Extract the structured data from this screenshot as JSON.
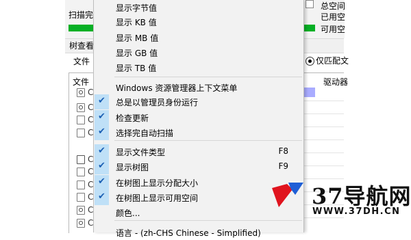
{
  "background_left": {
    "scan_label": "扫描完",
    "tab_label": "树查看",
    "file_types_label": "文件",
    "list_header": "文件",
    "rows": [
      {
        "icon": "gear-doc-icon",
        "letter": "C"
      },
      {
        "icon": "gear-doc-icon",
        "letter": "C"
      },
      {
        "icon": "document-icon",
        "letter": "C"
      },
      {
        "icon": "document-icon",
        "letter": "C"
      },
      {
        "icon": "shortcut-icon",
        "letter": "C"
      },
      {
        "icon": "document-icon",
        "letter": "C"
      },
      {
        "icon": "document-icon",
        "letter": "C"
      },
      {
        "icon": "document-icon",
        "letter": "C"
      },
      {
        "icon": "gear-doc-icon",
        "letter": "C"
      },
      {
        "icon": "gear-doc-icon",
        "letter": "C"
      }
    ]
  },
  "background_right": {
    "total_space": "总空间",
    "used_space": "已用空",
    "free_space": "可用空",
    "radio_label": "仅匹配文",
    "drive_header": "驱动器"
  },
  "context_menu": {
    "items": [
      {
        "label": "显示字节值",
        "checked": false
      },
      {
        "label": "显示 KB 值",
        "checked": false
      },
      {
        "label": "显示 MB 值",
        "checked": false
      },
      {
        "label": "显示 GB 值",
        "checked": false
      },
      {
        "label": "显示 TB 值",
        "checked": false
      },
      {
        "label": "Windows 资源管理器上下文菜单",
        "checked": false
      },
      {
        "label": "总是以管理员身份运行",
        "checked": true
      },
      {
        "label": "检查更新",
        "checked": true
      },
      {
        "label": "选择完自动扫描",
        "checked": true
      },
      {
        "label": "显示文件类型",
        "checked": true,
        "shortcut": "F8"
      },
      {
        "label": "显示树图",
        "checked": true,
        "shortcut": "F9"
      },
      {
        "label": "在树图上显示分配大小",
        "checked": true
      },
      {
        "label": "在树图上显示可用空间",
        "checked": true
      },
      {
        "label": "颜色...",
        "checked": false
      },
      {
        "label": "语言 - (zh-CHS Chinese - Simplified)",
        "checked": false
      }
    ]
  },
  "watermark": {
    "text": "37导航网",
    "url": "WWW.37DH.CN"
  },
  "colors": {
    "progress_green": "#06b025",
    "menu_background": "#f2f2f2",
    "check_highlight": "#bfe0f7",
    "drive_bar_purple": "#a9acff",
    "logo_red": "#e0141e",
    "logo_blue": "#1f5fd6"
  }
}
